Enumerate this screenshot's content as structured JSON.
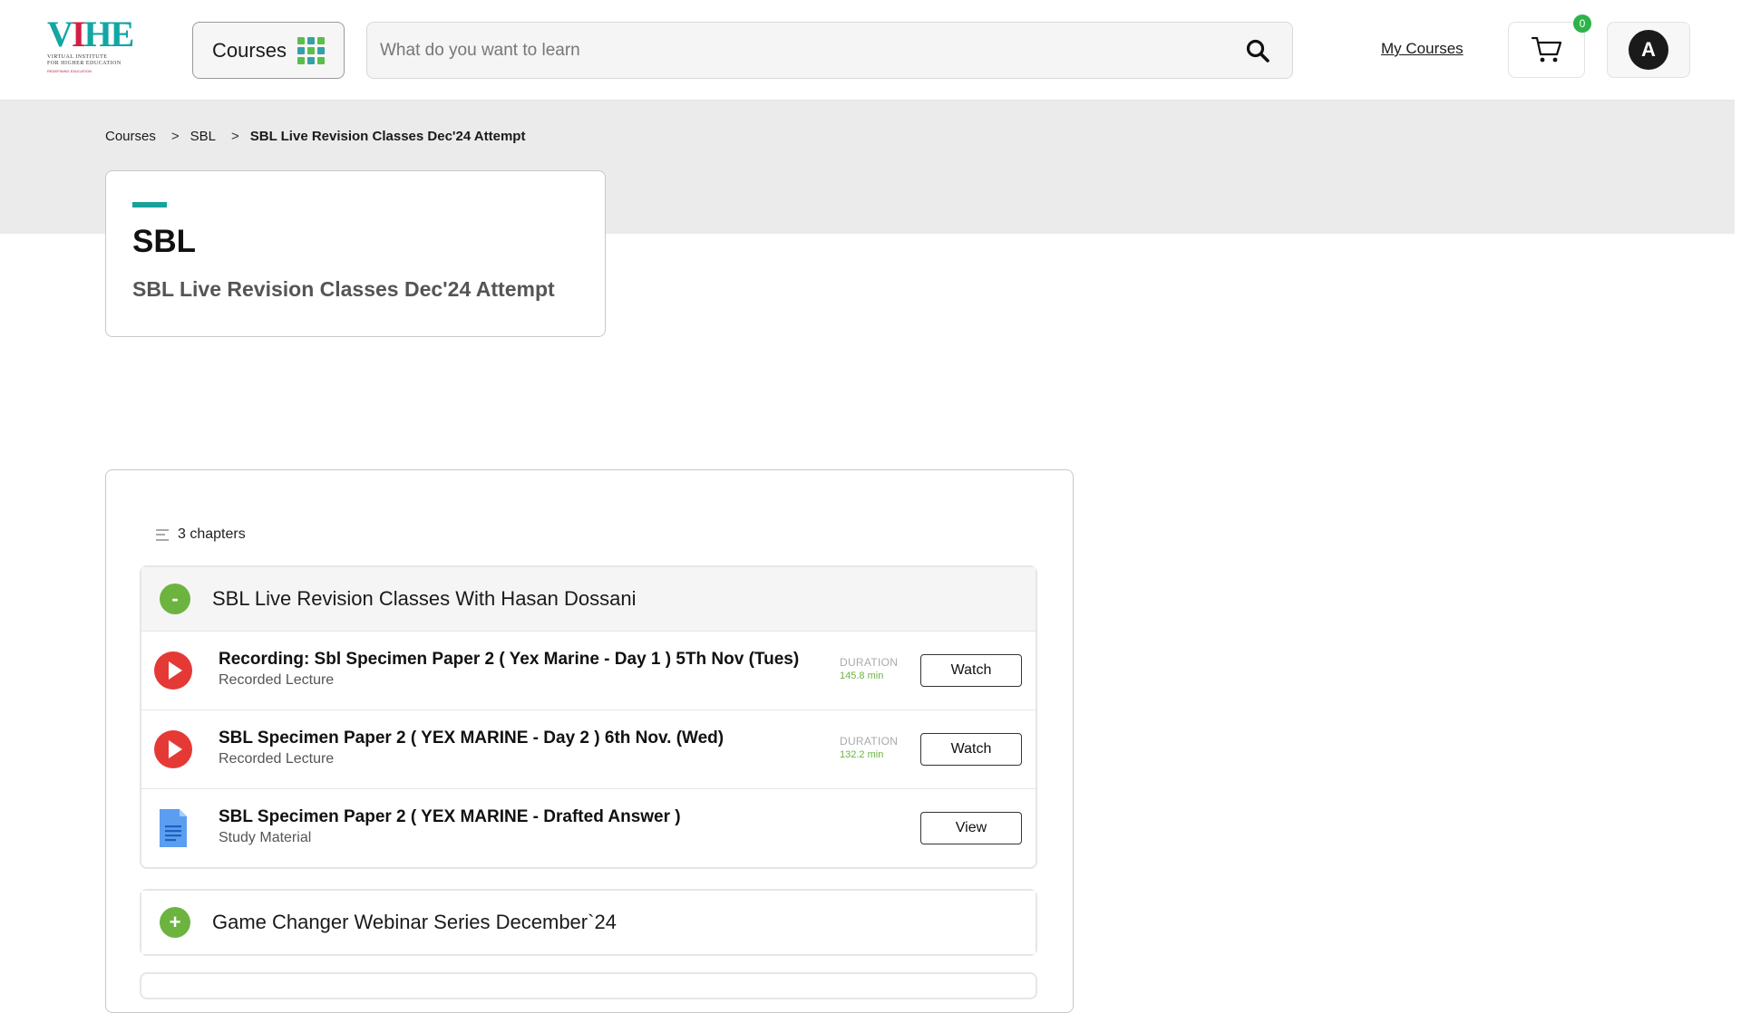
{
  "header": {
    "logo": {
      "text_main": "VIHE",
      "subtitle": "VIRTUAL INSTITUTE FOR HIGHER EDUCATION",
      "tagline": "REDEFINING EDUCATION"
    },
    "courses_label": "Courses",
    "search": {
      "placeholder": "What do you want to learn",
      "value": ""
    },
    "my_courses_label": "My Courses",
    "cart_count": "0",
    "avatar_initial": "A"
  },
  "breadcrumb": {
    "items": [
      "Courses",
      "SBL",
      "SBL Live Revision Classes Dec'24 Attempt"
    ],
    "separator": ">"
  },
  "course": {
    "title": "SBL",
    "subtitle": "SBL Live Revision Classes Dec'24 Attempt"
  },
  "curriculum": {
    "chapter_count": "3 chapters",
    "chapters": [
      {
        "title": "SBL Live Revision Classes With Hasan Dossani",
        "toggle": "-",
        "expanded": true,
        "lectures": [
          {
            "title": "Recording: Sbl Specimen Paper 2 ( Yex Marine - Day 1 ) 5Th Nov (Tues)",
            "type": "Recorded Lecture",
            "duration_label": "DURATION",
            "duration": "145.8 min",
            "action": "Watch",
            "icon": "play-icon"
          },
          {
            "title": "SBL Specimen Paper 2 ( YEX MARINE - Day 2 ) 6th Nov. (Wed)",
            "type": "Recorded Lecture",
            "duration_label": "DURATION",
            "duration": "132.2 min",
            "action": "Watch",
            "icon": "play-icon"
          },
          {
            "title": "SBL Specimen Paper 2 ( YEX MARINE - Drafted Answer )",
            "type": "Study Material",
            "action": "View",
            "icon": "document-icon"
          }
        ]
      },
      {
        "title": "Game Changer Webinar Series December`24",
        "toggle": "+",
        "expanded": false
      }
    ]
  },
  "colors": {
    "accent_teal": "#16a29b",
    "toggle_green": "#6cb43f",
    "play_red": "#e53935",
    "badge_green": "#2cb34a",
    "band_grey": "#ebebeb"
  }
}
